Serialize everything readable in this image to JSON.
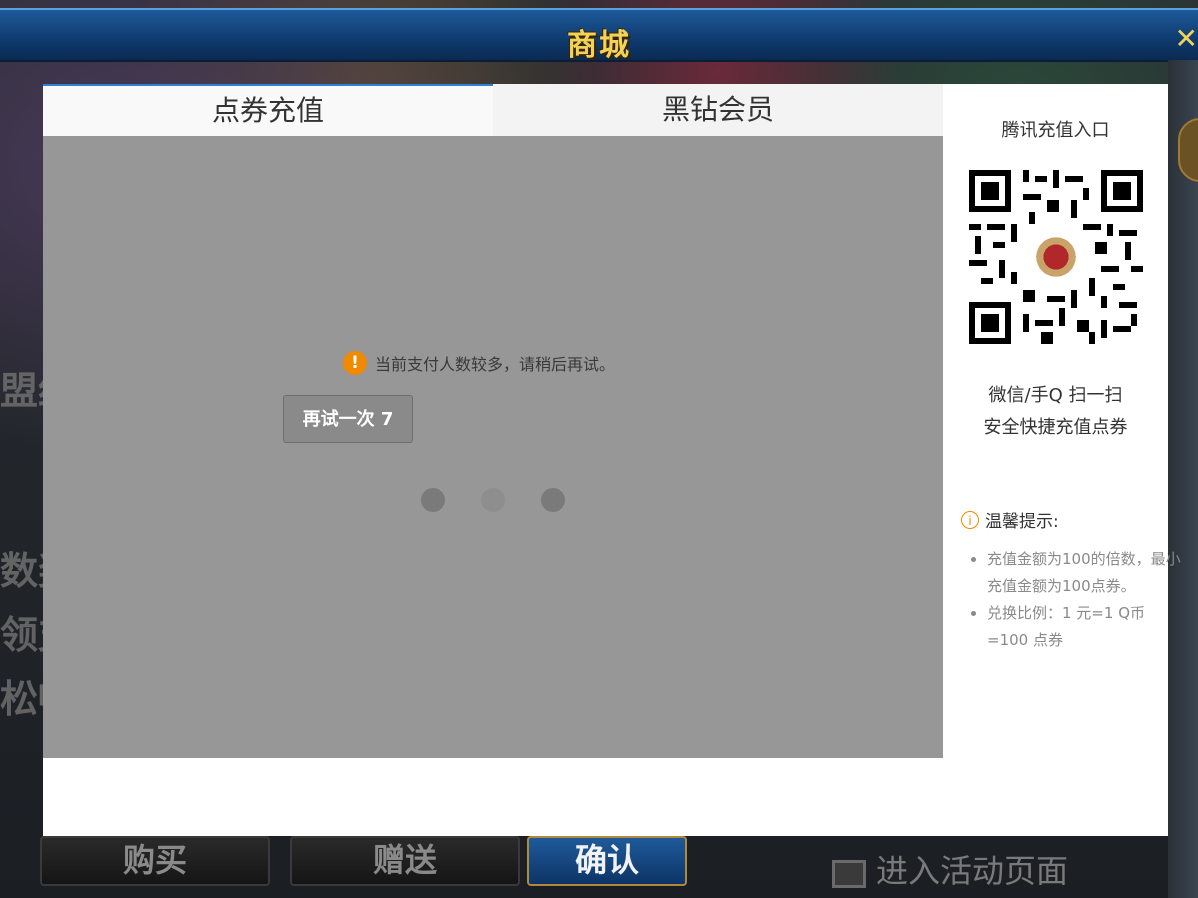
{
  "game": {
    "shop_title": "商城",
    "close_glyph": "✕",
    "left_fragments": [
      "盟约",
      "数奖",
      "领支",
      "松畅"
    ],
    "buttons": {
      "buy": "购买",
      "gift": "赠送",
      "confirm": "确认"
    },
    "activity_link": "进入活动页面"
  },
  "modal": {
    "tabs": [
      {
        "label": "点券充值"
      },
      {
        "label": "黑钻会员"
      }
    ],
    "notice": {
      "icon": "!",
      "text": "当前支付人数较多，请稍后再试。"
    },
    "retry_button": "再试一次 7",
    "side": {
      "title": "腾讯充值入口",
      "scan_line1": "微信/手Q 扫一扫",
      "scan_line2": "安全快捷充值点券",
      "tip_icon": "i",
      "tip_title": "温馨提示:",
      "tips": [
        "充值金额为100的倍数，最小充值金额为100点券。",
        "兑换比例：1 元=1 Q币=100 点券"
      ]
    }
  },
  "colors": {
    "accent_blue": "#2f80d8",
    "warning_orange": "#f08a00",
    "overlay_gray": "#979797"
  }
}
